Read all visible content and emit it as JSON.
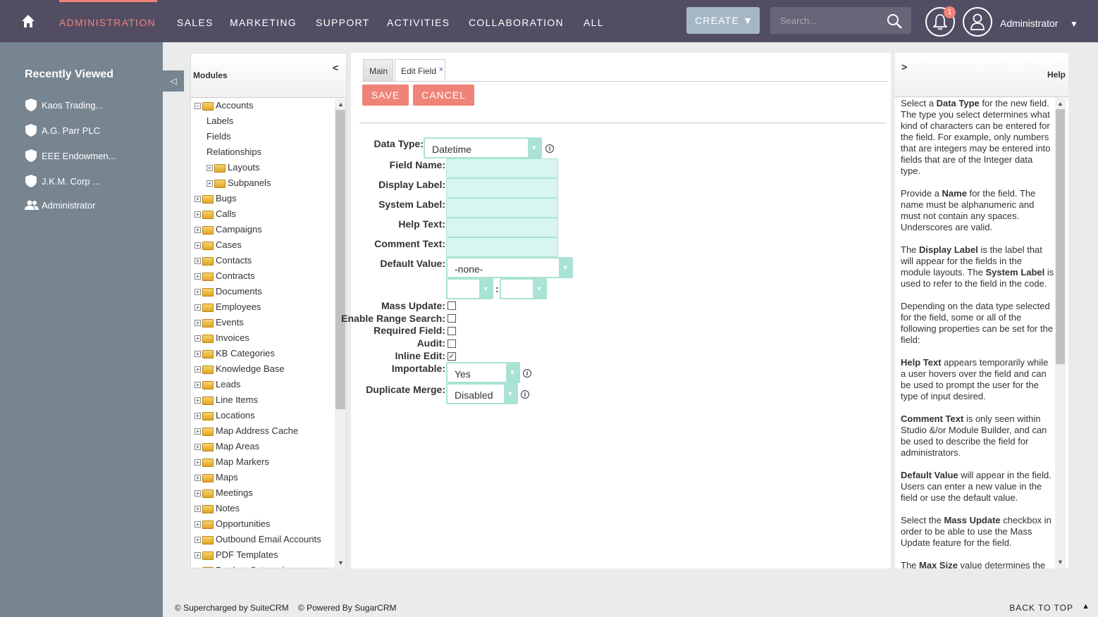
{
  "nav": {
    "tabs": [
      "ADMINISTRATION",
      "SALES",
      "MARKETING",
      "SUPPORT",
      "ACTIVITIES",
      "COLLABORATION",
      "ALL"
    ],
    "create_label": "CREATE",
    "search_placeholder": "Search...",
    "notification_count": "1",
    "user_name": "Administrator"
  },
  "sidebar": {
    "title": "Recently Viewed",
    "items": [
      {
        "label": "Kaos Trading...",
        "icon": "shield-icon"
      },
      {
        "label": "A.G. Parr PLC",
        "icon": "shield-icon"
      },
      {
        "label": "EEE Endowmen...",
        "icon": "shield-icon"
      },
      {
        "label": "J.K.M. Corp ...",
        "icon": "shield-icon"
      },
      {
        "label": "Administrator",
        "icon": "users-icon"
      }
    ]
  },
  "modules_panel": {
    "title": "Modules",
    "collapse": "<",
    "tree": [
      {
        "label": "Accounts",
        "level": 0,
        "expanded": true
      },
      {
        "label": "Labels",
        "level": 1,
        "leaf": true
      },
      {
        "label": "Fields",
        "level": 1,
        "leaf": true
      },
      {
        "label": "Relationships",
        "level": 1,
        "leaf": true
      },
      {
        "label": "Layouts",
        "level": 1
      },
      {
        "label": "Subpanels",
        "level": 1
      },
      {
        "label": "Bugs",
        "level": 0
      },
      {
        "label": "Calls",
        "level": 0
      },
      {
        "label": "Campaigns",
        "level": 0
      },
      {
        "label": "Cases",
        "level": 0
      },
      {
        "label": "Contacts",
        "level": 0
      },
      {
        "label": "Contracts",
        "level": 0
      },
      {
        "label": "Documents",
        "level": 0
      },
      {
        "label": "Employees",
        "level": 0
      },
      {
        "label": "Events",
        "level": 0
      },
      {
        "label": "Invoices",
        "level": 0
      },
      {
        "label": "KB Categories",
        "level": 0
      },
      {
        "label": "Knowledge Base",
        "level": 0
      },
      {
        "label": "Leads",
        "level": 0
      },
      {
        "label": "Line Items",
        "level": 0
      },
      {
        "label": "Locations",
        "level": 0
      },
      {
        "label": "Map Address Cache",
        "level": 0
      },
      {
        "label": "Map Areas",
        "level": 0
      },
      {
        "label": "Map Markers",
        "level": 0
      },
      {
        "label": "Maps",
        "level": 0
      },
      {
        "label": "Meetings",
        "level": 0
      },
      {
        "label": "Notes",
        "level": 0
      },
      {
        "label": "Opportunities",
        "level": 0
      },
      {
        "label": "Outbound Email Accounts",
        "level": 0
      },
      {
        "label": "PDF Templates",
        "level": 0
      },
      {
        "label": "Product Categories",
        "level": 0
      }
    ]
  },
  "editor": {
    "tabs": [
      "Main",
      "Edit Field"
    ],
    "save_label": "SAVE",
    "cancel_label": "CANCEL",
    "data_type_label": "Data Type:",
    "data_type_value": "Datetime",
    "field_name_label": "Field Name:",
    "display_label_label": "Display Label:",
    "system_label_label": "System Label:",
    "help_text_label": "Help Text:",
    "comment_text_label": "Comment Text:",
    "default_value_label": "Default Value:",
    "default_value_value": "-none-",
    "time_separator": ":",
    "mass_update_label": "Mass Update:",
    "range_search_label": "Enable Range Search:",
    "required_label": "Required Field:",
    "audit_label": "Audit:",
    "inline_edit_label": "Inline Edit:",
    "importable_label": "Importable:",
    "importable_value": "Yes",
    "duplicate_merge_label": "Duplicate Merge:",
    "duplicate_merge_value": "Disabled",
    "checks": {
      "mass_update": false,
      "range_search": false,
      "required": false,
      "audit": false,
      "inline_edit": true
    }
  },
  "help_panel": {
    "title": "Help",
    "expand": ">"
  },
  "footer": {
    "left": "© Supercharged by SuiteCRM    © Powered By SugarCRM",
    "right": "BACK TO TOP"
  }
}
